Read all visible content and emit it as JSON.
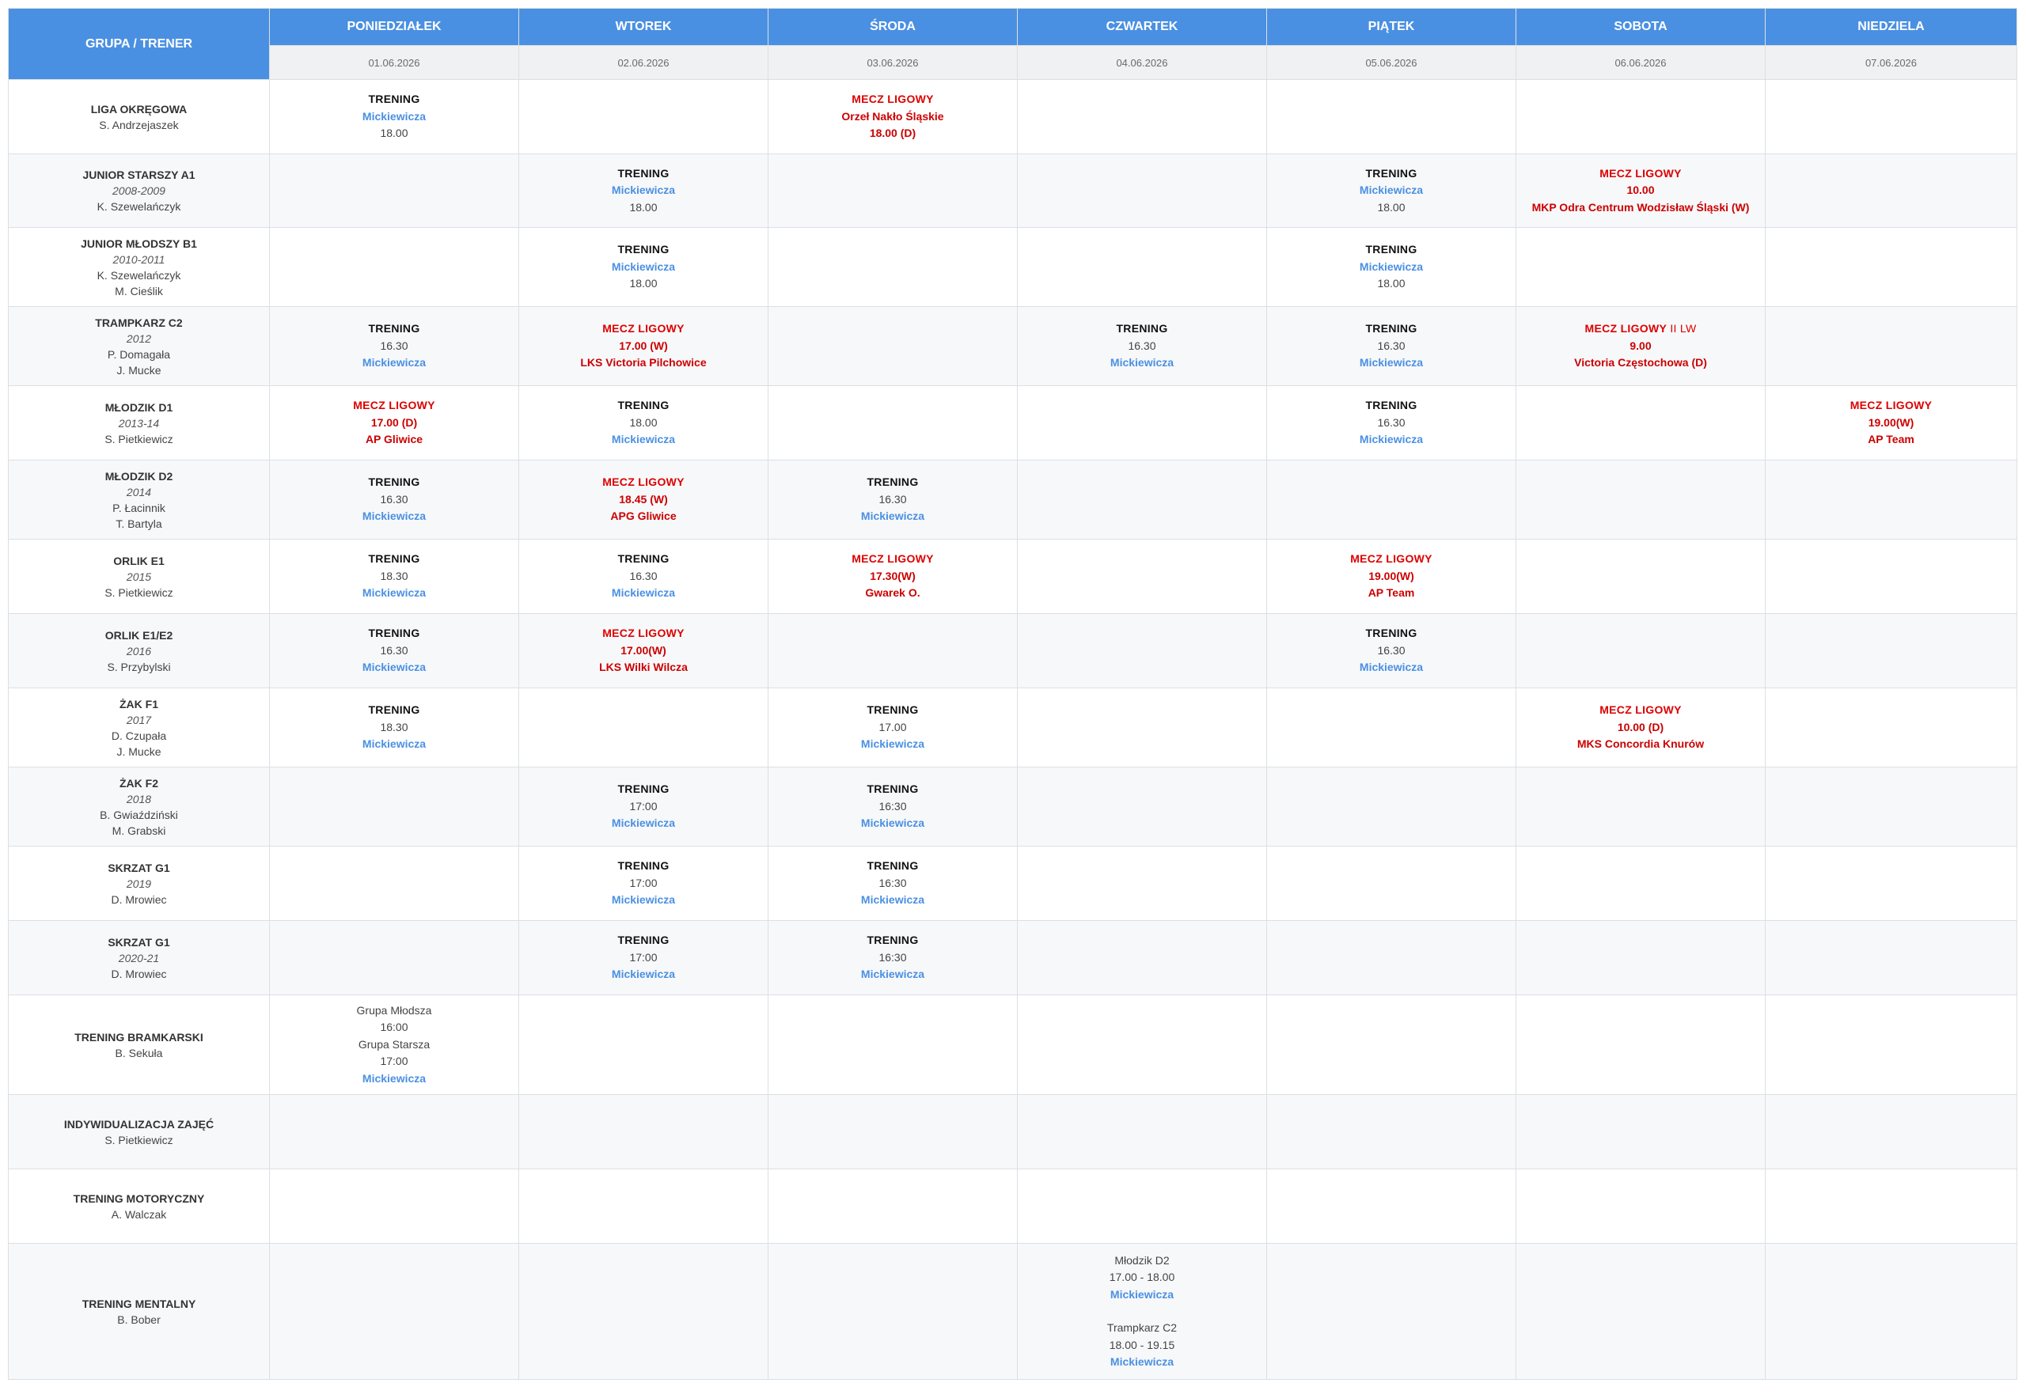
{
  "header": {
    "group_label": "GRUPA / TRENER",
    "days": [
      {
        "name": "PONIEDZIAŁEK",
        "date": "01.06.2026"
      },
      {
        "name": "WTOREK",
        "date": "02.06.2026"
      },
      {
        "name": "ŚRODA",
        "date": "03.06.2026"
      },
      {
        "name": "CZWARTEK",
        "date": "04.06.2026"
      },
      {
        "name": "PIĄTEK",
        "date": "05.06.2026"
      },
      {
        "name": "SOBOTA",
        "date": "06.06.2026"
      },
      {
        "name": "NIEDZIELA",
        "date": "07.06.2026"
      }
    ]
  },
  "colors": {
    "header_bg": "#4a90e2",
    "match_red": "#dd0000",
    "place_blue": "#4a90e2",
    "date_row_bg": "#f0f1f3"
  },
  "rows": [
    {
      "group": {
        "name": "LIGA OKRĘGOWA",
        "years": "",
        "coaches": [
          "S. Andrzejaszek"
        ]
      },
      "cells": [
        {
          "title": "TRENING",
          "lines": [
            {
              "t": "Mickiewicza",
              "s": "place"
            },
            {
              "t": "18.00",
              "s": "time"
            }
          ]
        },
        null,
        {
          "title": "MECZ LIGOWY",
          "match": true,
          "lines": [
            {
              "t": "Orzeł Nakło Śląskie",
              "s": "opp"
            },
            {
              "t": "18.00 (D)",
              "s": "redtime"
            }
          ]
        },
        null,
        null,
        null,
        null
      ]
    },
    {
      "group": {
        "name": "JUNIOR STARSZY A1",
        "years": "2008-2009",
        "coaches": [
          "K. Szewelańczyk"
        ]
      },
      "cells": [
        null,
        {
          "title": "TRENING",
          "lines": [
            {
              "t": "Mickiewicza",
              "s": "place"
            },
            {
              "t": "18.00",
              "s": "time"
            }
          ]
        },
        null,
        null,
        {
          "title": "TRENING",
          "lines": [
            {
              "t": "Mickiewicza",
              "s": "place"
            },
            {
              "t": "18.00",
              "s": "time"
            }
          ]
        },
        {
          "title": "MECZ LIGOWY",
          "match": true,
          "lines": [
            {
              "t": "10.00",
              "s": "redtime"
            },
            {
              "t": "MKP Odra Centrum Wodzisław Śląski (W)",
              "s": "opp"
            }
          ]
        },
        null
      ]
    },
    {
      "group": {
        "name": "JUNIOR MŁODSZY B1",
        "years": "2010-2011",
        "coaches": [
          "K. Szewelańczyk",
          "M. Cieślik"
        ]
      },
      "cells": [
        null,
        {
          "title": "TRENING",
          "lines": [
            {
              "t": "Mickiewicza",
              "s": "place"
            },
            {
              "t": "18.00",
              "s": "time"
            }
          ]
        },
        null,
        null,
        {
          "title": "TRENING",
          "lines": [
            {
              "t": "Mickiewicza",
              "s": "place"
            },
            {
              "t": "18.00",
              "s": "time"
            }
          ]
        },
        null,
        null
      ]
    },
    {
      "group": {
        "name": "TRAMPKARZ C2",
        "years": "2012",
        "coaches": [
          "P. Domagała",
          "J. Mucke"
        ]
      },
      "cells": [
        {
          "title": "TRENING",
          "lines": [
            {
              "t": "16.30",
              "s": "time"
            },
            {
              "t": "Mickiewicza",
              "s": "place"
            }
          ]
        },
        {
          "title": "MECZ LIGOWY",
          "match": true,
          "lines": [
            {
              "t": "17.00 (W)",
              "s": "redtime"
            },
            {
              "t": "LKS Victoria Pilchowice",
              "s": "opp"
            }
          ]
        },
        null,
        {
          "title": "TRENING",
          "lines": [
            {
              "t": "16.30",
              "s": "time"
            },
            {
              "t": "Mickiewicza",
              "s": "place"
            }
          ]
        },
        {
          "title": "TRENING",
          "lines": [
            {
              "t": "16.30",
              "s": "time"
            },
            {
              "t": "Mickiewicza",
              "s": "place"
            }
          ]
        },
        {
          "title": "MECZ LIGOWY",
          "sub": " II LW",
          "match": true,
          "lines": [
            {
              "t": "9.00",
              "s": "redtime"
            },
            {
              "t": "Victoria Częstochowa (D)",
              "s": "opp"
            }
          ]
        },
        null
      ]
    },
    {
      "group": {
        "name": "MŁODZIK D1",
        "years": "2013-14",
        "coaches": [
          "S. Pietkiewicz"
        ]
      },
      "cells": [
        {
          "title": "MECZ LIGOWY",
          "match": true,
          "lines": [
            {
              "t": "17.00 (D)",
              "s": "redtime"
            },
            {
              "t": "AP Gliwice",
              "s": "opp"
            }
          ]
        },
        {
          "title": "TRENING",
          "lines": [
            {
              "t": "18.00",
              "s": "time"
            },
            {
              "t": "Mickiewicza",
              "s": "place"
            }
          ]
        },
        null,
        null,
        {
          "title": "TRENING",
          "lines": [
            {
              "t": "16.30",
              "s": "time"
            },
            {
              "t": "Mickiewicza",
              "s": "place"
            }
          ]
        },
        null,
        {
          "title": "MECZ LIGOWY",
          "match": true,
          "lines": [
            {
              "t": "19.00(W)",
              "s": "redtime"
            },
            {
              "t": "AP Team",
              "s": "opp"
            }
          ]
        }
      ]
    },
    {
      "group": {
        "name": "MŁODZIK D2",
        "years": "2014",
        "coaches": [
          "P. Łacinnik",
          "T. Bartyla"
        ]
      },
      "cells": [
        {
          "title": "TRENING",
          "lines": [
            {
              "t": "16.30",
              "s": "time"
            },
            {
              "t": "Mickiewicza",
              "s": "place"
            }
          ]
        },
        {
          "title": "MECZ LIGOWY",
          "match": true,
          "lines": [
            {
              "t": "18.45 (W)",
              "s": "redtime"
            },
            {
              "t": "APG Gliwice",
              "s": "opp"
            }
          ]
        },
        {
          "title": "TRENING",
          "lines": [
            {
              "t": "16.30",
              "s": "time"
            },
            {
              "t": "Mickiewicza",
              "s": "place"
            }
          ]
        },
        null,
        null,
        null,
        null
      ]
    },
    {
      "group": {
        "name": "ORLIK E1",
        "years": "2015",
        "coaches": [
          "S. Pietkiewicz"
        ]
      },
      "cells": [
        {
          "title": "TRENING",
          "lines": [
            {
              "t": "18.30",
              "s": "time"
            },
            {
              "t": "Mickiewicza",
              "s": "place"
            }
          ]
        },
        {
          "title": "TRENING",
          "lines": [
            {
              "t": "16.30",
              "s": "time"
            },
            {
              "t": "Mickiewicza",
              "s": "place"
            }
          ]
        },
        {
          "title": "MECZ LIGOWY",
          "match": true,
          "lines": [
            {
              "t": "17.30(W)",
              "s": "redtime"
            },
            {
              "t": "Gwarek O.",
              "s": "opp"
            }
          ]
        },
        null,
        {
          "title": "MECZ LIGOWY",
          "match": true,
          "lines": [
            {
              "t": "19.00(W)",
              "s": "redtime"
            },
            {
              "t": "AP Team",
              "s": "opp"
            }
          ]
        },
        null,
        null
      ]
    },
    {
      "group": {
        "name": "ORLIK E1/E2",
        "years": "2016",
        "coaches": [
          "S. Przybylski"
        ]
      },
      "cells": [
        {
          "title": "TRENING",
          "lines": [
            {
              "t": "16.30",
              "s": "time"
            },
            {
              "t": "Mickiewicza",
              "s": "place"
            }
          ]
        },
        {
          "title": "MECZ LIGOWY",
          "match": true,
          "lines": [
            {
              "t": "17.00(W)",
              "s": "redtime"
            },
            {
              "t": "LKS Wilki Wilcza",
              "s": "opp"
            }
          ]
        },
        null,
        null,
        {
          "title": "TRENING",
          "lines": [
            {
              "t": "16.30",
              "s": "time"
            },
            {
              "t": "Mickiewicza",
              "s": "place"
            }
          ]
        },
        null,
        null
      ]
    },
    {
      "group": {
        "name": "ŻAK F1",
        "years": "2017",
        "coaches": [
          "D. Czupała",
          "J. Mucke"
        ]
      },
      "cells": [
        {
          "title": "TRENING",
          "lines": [
            {
              "t": "18.30",
              "s": "time"
            },
            {
              "t": "Mickiewicza",
              "s": "place"
            }
          ]
        },
        null,
        {
          "title": "TRENING",
          "lines": [
            {
              "t": "17.00",
              "s": "time"
            },
            {
              "t": "Mickiewicza",
              "s": "place"
            }
          ]
        },
        null,
        null,
        {
          "title": "MECZ LIGOWY",
          "match": true,
          "lines": [
            {
              "t": "10.00 (D)",
              "s": "redtime"
            },
            {
              "t": "MKS Concordia Knurów",
              "s": "opp"
            }
          ]
        },
        null
      ]
    },
    {
      "group": {
        "name": "ŻAK F2",
        "years": "2018",
        "coaches": [
          "B. Gwiaździński",
          "M. Grabski"
        ]
      },
      "cells": [
        null,
        {
          "title": "TRENING",
          "lines": [
            {
              "t": "17:00",
              "s": "time"
            },
            {
              "t": "Mickiewicza",
              "s": "place"
            }
          ]
        },
        {
          "title": "TRENING",
          "lines": [
            {
              "t": "16:30",
              "s": "time"
            },
            {
              "t": "Mickiewicza",
              "s": "place"
            }
          ]
        },
        null,
        null,
        null,
        null
      ]
    },
    {
      "group": {
        "name": "SKRZAT G1",
        "years": "2019",
        "coaches": [
          "D. Mrowiec"
        ]
      },
      "cells": [
        null,
        {
          "title": "TRENING",
          "lines": [
            {
              "t": "17:00",
              "s": "time"
            },
            {
              "t": "Mickiewicza",
              "s": "place"
            }
          ]
        },
        {
          "title": "TRENING",
          "lines": [
            {
              "t": "16:30",
              "s": "time"
            },
            {
              "t": "Mickiewicza",
              "s": "place"
            }
          ]
        },
        null,
        null,
        null,
        null
      ]
    },
    {
      "group": {
        "name": "SKRZAT G1",
        "years": "2020-21",
        "coaches": [
          "D. Mrowiec"
        ]
      },
      "cells": [
        null,
        {
          "title": "TRENING",
          "lines": [
            {
              "t": "17:00",
              "s": "time"
            },
            {
              "t": "Mickiewicza",
              "s": "place"
            }
          ]
        },
        {
          "title": "TRENING",
          "lines": [
            {
              "t": "16:30",
              "s": "time"
            },
            {
              "t": "Mickiewicza",
              "s": "place"
            }
          ]
        },
        null,
        null,
        null,
        null
      ]
    },
    {
      "group": {
        "name": "TRENING BRAMKARSKI",
        "years": "",
        "coaches": [
          "B. Sekuła"
        ]
      },
      "cells": [
        {
          "title": "",
          "lines": [
            {
              "t": "Grupa Młodsza",
              "s": "line"
            },
            {
              "t": "16:00",
              "s": "line"
            },
            {
              "t": "Grupa Starsza",
              "s": "line"
            },
            {
              "t": "17:00",
              "s": "line"
            },
            {
              "t": "Mickiewicza",
              "s": "place"
            }
          ]
        },
        null,
        null,
        null,
        null,
        null,
        null
      ]
    },
    {
      "group": {
        "name": "INDYWIDUALIZACJA ZAJĘĆ",
        "years": "",
        "coaches": [
          "S. Pietkiewicz"
        ]
      },
      "cells": [
        null,
        null,
        null,
        null,
        null,
        null,
        null
      ]
    },
    {
      "group": {
        "name": "TRENING MOTORYCZNY",
        "years": "",
        "coaches": [
          "A. Walczak"
        ]
      },
      "cells": [
        null,
        null,
        null,
        null,
        null,
        null,
        null
      ]
    },
    {
      "group": {
        "name": "TRENING MENTALNY",
        "years": "",
        "coaches": [
          "B. Bober"
        ]
      },
      "cells": [
        null,
        null,
        null,
        {
          "title": "",
          "lines": [
            {
              "t": "Młodzik D2",
              "s": "line"
            },
            {
              "t": "17.00 - 18.00",
              "s": "line"
            },
            {
              "t": "Mickiewicza",
              "s": "place"
            },
            {
              "t": "",
              "s": "gap"
            },
            {
              "t": "Trampkarz C2",
              "s": "line"
            },
            {
              "t": "18.00 - 19.15",
              "s": "line"
            },
            {
              "t": "Mickiewicza",
              "s": "place"
            }
          ]
        },
        null,
        null,
        null
      ]
    }
  ]
}
